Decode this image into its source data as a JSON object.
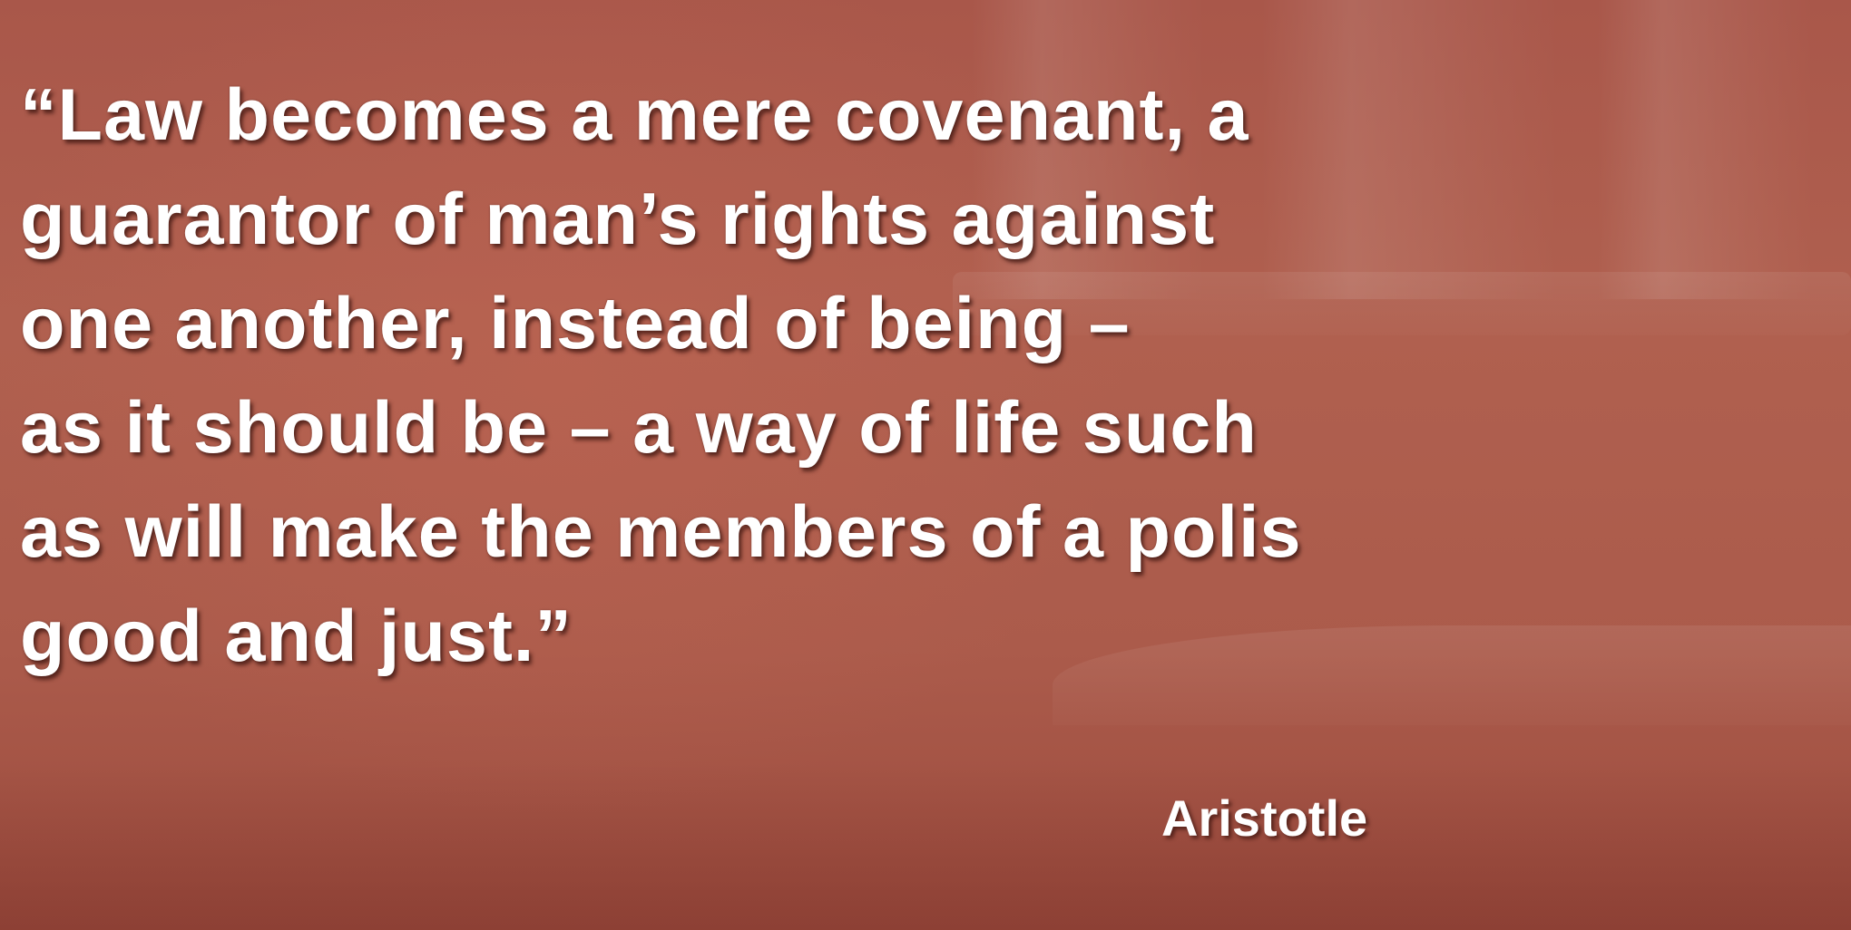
{
  "quote": {
    "lines": [
      "“Law becomes a mere covenant, a",
      "guarantor of man’s rights against",
      "one another, instead of being –",
      "as it should be – a way of life such",
      "as will make the members of a polis",
      "good and just.”"
    ]
  },
  "attribution": "Aristotle",
  "colors": {
    "background": "#a85447",
    "text": "#ffffff"
  }
}
